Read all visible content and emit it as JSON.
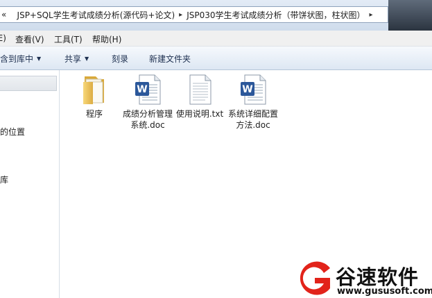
{
  "address_bar": {
    "back_glyph": "«",
    "crumbs": [
      "JSP+SQL学生考试成绩分析(源代码+论文)",
      "JSP030学生考试成绩分析（带饼状图，柱状图）"
    ],
    "separator": "▸"
  },
  "menu": {
    "items": [
      "(E)",
      "查看(V)",
      "工具(T)",
      "帮助(H)"
    ]
  },
  "toolbar": {
    "include_library": "含到库中",
    "share": "共享",
    "burn": "刻录",
    "new_folder": "新建文件夹"
  },
  "nav": {
    "recent_places": "的位置",
    "libraries": "库"
  },
  "files": [
    {
      "name": "程序",
      "type": "folder"
    },
    {
      "name": "成绩分析管理系统.doc",
      "type": "word"
    },
    {
      "name": "使用说明.txt",
      "type": "txt"
    },
    {
      "name": "系统详细配置方法.doc",
      "type": "word"
    }
  ],
  "watermark": {
    "brand": "谷速软件",
    "url": "www.gususoft.com",
    "color": "#e2231a"
  }
}
